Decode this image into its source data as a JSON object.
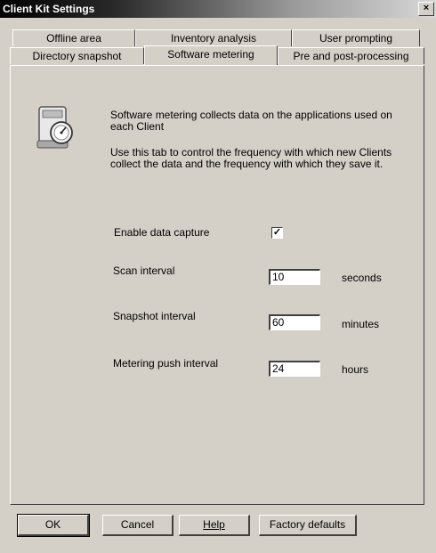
{
  "window": {
    "title": "Client Kit Settings",
    "close_glyph": "×"
  },
  "tabs_row1": [
    "Offline area",
    "Inventory analysis",
    "User prompting"
  ],
  "tabs_row2": [
    "Directory snapshot",
    "Software metering",
    "Pre and post-processing"
  ],
  "active_tab": "Software metering",
  "description": {
    "line1": "Software metering collects data on the applications used on",
    "line2": "each  Client",
    "line3": "Use this tab to control the frequency with which new Clients",
    "line4": "collect the data and the frequency with which they save it."
  },
  "fields": {
    "enable_label": "Enable data capture",
    "enable_checked": true,
    "check_glyph": "✓",
    "scan_label": "Scan interval",
    "scan_value": "10",
    "scan_unit": "seconds",
    "snapshot_label": "Snapshot interval",
    "snapshot_value": "60",
    "snapshot_unit": "minutes",
    "push_label": "Metering push interval",
    "push_value": "24",
    "push_unit": "hours"
  },
  "buttons": {
    "ok": "OK",
    "cancel": "Cancel",
    "help": "Help",
    "factory": "Factory defaults"
  },
  "icon": "software-metering-gauge-icon"
}
